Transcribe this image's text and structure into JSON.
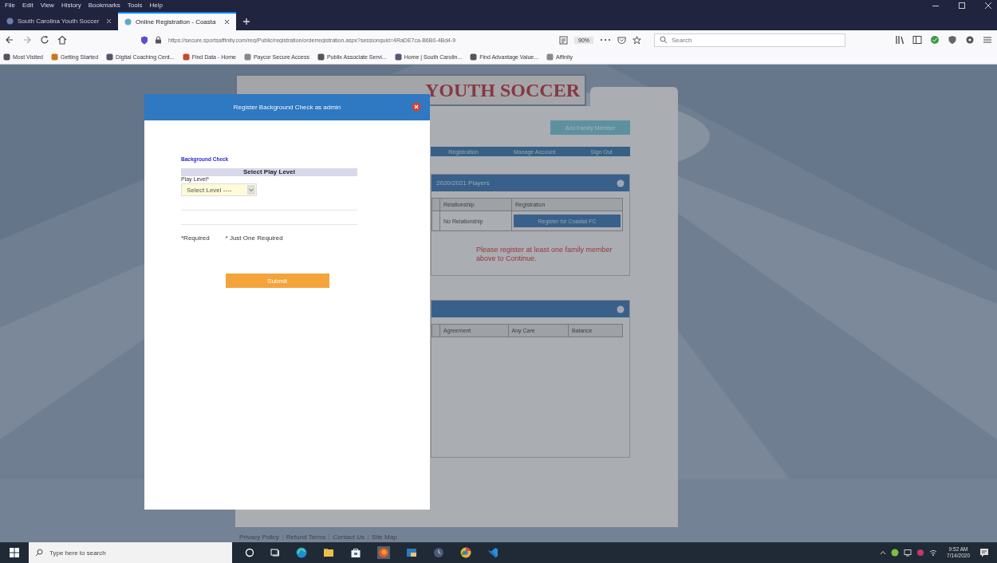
{
  "browser": {
    "menu": [
      "File",
      "Edit",
      "View",
      "History",
      "Bookmarks",
      "Tools",
      "Help"
    ],
    "tabs": [
      {
        "title": "South Carolina Youth Soccer",
        "selected": false
      },
      {
        "title": "Online Registration - Coasta",
        "selected": true
      }
    ],
    "url": "https://secure.sportsaffinity.com/reg/Public/registration/orderregistration.aspx?sessionguid=4RaDE7ca-B6B0-4Bd4-9",
    "zoom": "90%",
    "search_placeholder": "Search",
    "bookmarks": [
      "Most Visited",
      "Getting Started",
      "Digital Coaching Cent...",
      "Find Data - Home",
      "Paycor Secure Access",
      "Publix Associate Servi...",
      "Home | South Carolin...",
      "Find Advantage Value...",
      "Affinity"
    ]
  },
  "page": {
    "banner": "YOUTH SOCCER",
    "action_button": "Add Family Member",
    "nav": [
      "Registration",
      "Manage Account",
      "Sign Out"
    ],
    "panels": [
      {
        "title": "2020/2021 Players",
        "columns": [
          "Relationship",
          "Registration"
        ],
        "rows": [
          [
            {
              "kind": "text",
              "text": "No Relationship"
            },
            {
              "kind": "button",
              "text": "Register for Coastal FC"
            }
          ]
        ],
        "message": "Please register at least one family member above to Continue."
      },
      {
        "columns": [
          "Agreement",
          "Any Care",
          "Balance"
        ]
      }
    ],
    "footer": [
      "Privacy Policy",
      "Refund Terms",
      "Contact Us",
      "Site Map"
    ]
  },
  "dialog": {
    "title": "Register Background Check as admin",
    "section": "Background Check",
    "heading": "Select Play Level",
    "field_label": "Play Level*",
    "select_value": "Select Level ----",
    "notes": [
      "*Required",
      "* Just One Required"
    ],
    "button": "Submit"
  },
  "taskbar": {
    "search_placeholder": "Type here to search",
    "time": "9:52 AM",
    "date": "7/14/2020"
  }
}
